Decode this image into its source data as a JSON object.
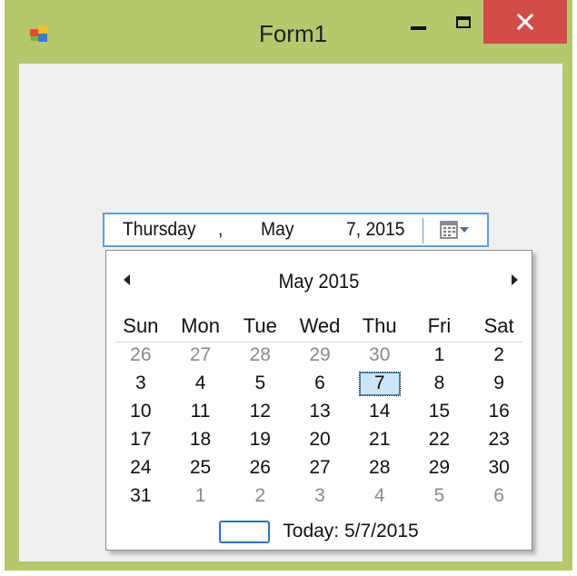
{
  "window": {
    "title": "Form1",
    "icons": {
      "app": "winforms-app-icon",
      "minimize": "minimize-icon",
      "maximize": "maximize-icon",
      "close": "close-icon"
    },
    "colors": {
      "frame": "#b5c86e",
      "close": "#d24c49",
      "client": "#f0f0f0"
    }
  },
  "date_picker": {
    "day_of_week": "Thursday",
    "comma": ",",
    "month": "May",
    "day_year": "7, 2015",
    "dropdown_icon": "calendar-dropdown-icon",
    "border_color": "#5a9fd8"
  },
  "calendar": {
    "month_title": "May 2015",
    "prev_icon": "left-arrow-icon",
    "next_icon": "right-arrow-icon",
    "weekdays": [
      "Sun",
      "Mon",
      "Tue",
      "Wed",
      "Thu",
      "Fri",
      "Sat"
    ],
    "weeks": [
      [
        {
          "d": "26",
          "o": true
        },
        {
          "d": "27",
          "o": true
        },
        {
          "d": "28",
          "o": true
        },
        {
          "d": "29",
          "o": true
        },
        {
          "d": "30",
          "o": true
        },
        {
          "d": "1",
          "o": false
        },
        {
          "d": "2",
          "o": false
        }
      ],
      [
        {
          "d": "3",
          "o": false
        },
        {
          "d": "4",
          "o": false
        },
        {
          "d": "5",
          "o": false
        },
        {
          "d": "6",
          "o": false
        },
        {
          "d": "7",
          "o": false,
          "selected": true
        },
        {
          "d": "8",
          "o": false
        },
        {
          "d": "9",
          "o": false
        }
      ],
      [
        {
          "d": "10",
          "o": false
        },
        {
          "d": "11",
          "o": false
        },
        {
          "d": "12",
          "o": false
        },
        {
          "d": "13",
          "o": false
        },
        {
          "d": "14",
          "o": false
        },
        {
          "d": "15",
          "o": false
        },
        {
          "d": "16",
          "o": false
        }
      ],
      [
        {
          "d": "17",
          "o": false
        },
        {
          "d": "18",
          "o": false
        },
        {
          "d": "19",
          "o": false
        },
        {
          "d": "20",
          "o": false
        },
        {
          "d": "21",
          "o": false
        },
        {
          "d": "22",
          "o": false
        },
        {
          "d": "23",
          "o": false
        }
      ],
      [
        {
          "d": "24",
          "o": false
        },
        {
          "d": "25",
          "o": false
        },
        {
          "d": "26",
          "o": false
        },
        {
          "d": "27",
          "o": false
        },
        {
          "d": "28",
          "o": false
        },
        {
          "d": "29",
          "o": false
        },
        {
          "d": "30",
          "o": false
        }
      ],
      [
        {
          "d": "31",
          "o": false
        },
        {
          "d": "1",
          "o": true
        },
        {
          "d": "2",
          "o": true
        },
        {
          "d": "3",
          "o": true
        },
        {
          "d": "4",
          "o": true
        },
        {
          "d": "5",
          "o": true
        },
        {
          "d": "6",
          "o": true
        }
      ]
    ],
    "today_label": "Today: 5/7/2015",
    "selected_color": "#cde6f7"
  }
}
